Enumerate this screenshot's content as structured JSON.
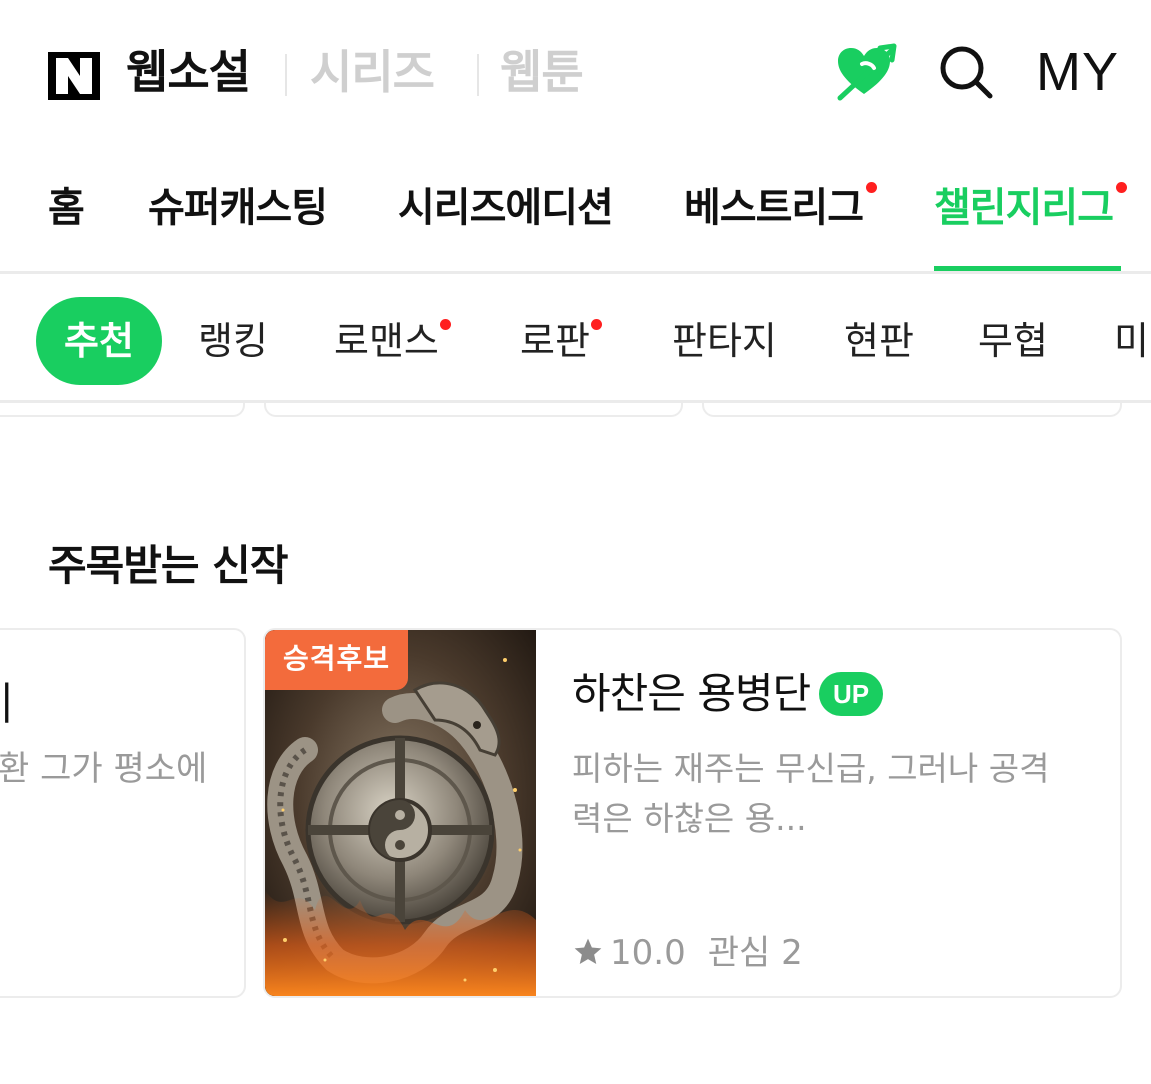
{
  "header": {
    "logo": "N",
    "brand": "웹소설",
    "services": [
      "시리즈",
      "웹툰"
    ],
    "my_label": "MY",
    "icons": {
      "heart": "heart-arrow-icon",
      "search": "search-icon"
    },
    "accent_color": "#19ce60"
  },
  "main_tabs": [
    {
      "label": "홈",
      "new_dot": false,
      "active": false
    },
    {
      "label": "슈퍼캐스팅",
      "new_dot": false,
      "active": false
    },
    {
      "label": "시리즈에디션",
      "new_dot": false,
      "active": false
    },
    {
      "label": "베스트리그",
      "new_dot": true,
      "active": false
    },
    {
      "label": "챌린지리그",
      "new_dot": true,
      "active": true
    }
  ],
  "genres": [
    {
      "label": "추천",
      "active": true,
      "new_dot": false
    },
    {
      "label": "랭킹",
      "active": false,
      "new_dot": false
    },
    {
      "label": "로맨스",
      "active": false,
      "new_dot": true
    },
    {
      "label": "로판",
      "active": false,
      "new_dot": true
    },
    {
      "label": "판타지",
      "active": false,
      "new_dot": false
    },
    {
      "label": "현판",
      "active": false,
      "new_dot": false
    },
    {
      "label": "무협",
      "active": false,
      "new_dot": false
    },
    {
      "label": "미",
      "active": false,
      "new_dot": false
    }
  ],
  "section": {
    "title": "주목받는 신작",
    "prev_card": {
      "title_fragment": "|",
      "desc_fragment": "환 그가 평소에"
    },
    "card": {
      "promo_badge": "승격후보",
      "title": "하찬은 용병단",
      "up_badge": "UP",
      "description": "피하는 재주는 무신급, 그러나 공격력은 하찮은 용...",
      "rating": "10.0",
      "interest": "관심 2",
      "badge_color": "#f36b3c"
    }
  }
}
